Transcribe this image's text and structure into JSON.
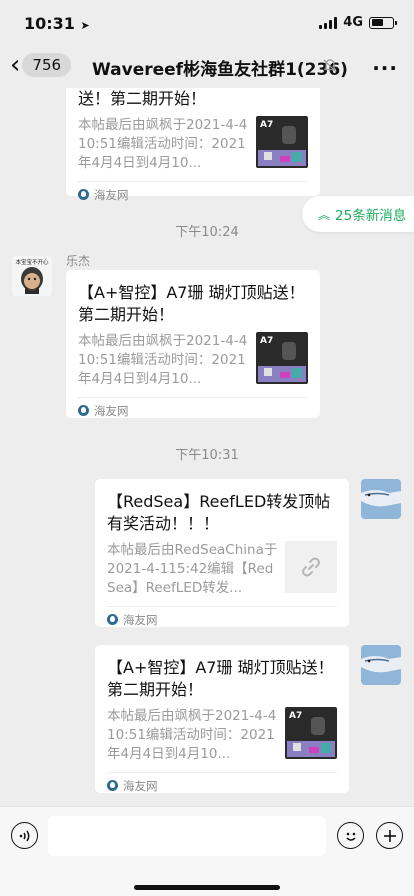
{
  "status_bar": {
    "time": "10:31",
    "network": "4G"
  },
  "nav": {
    "unread_count": "756",
    "title": "Wavereef彬海鱼友社群1(236)"
  },
  "new_messages": {
    "label": "25条新消息"
  },
  "messages": [
    {
      "title": "送！第二期开始！",
      "desc": "本帖最后由飒枫于2021-4-410:51编辑活动时间：2021年4月4日到4月10...",
      "source": "海友网",
      "thumb_label": "A7"
    },
    {
      "time_separator": "下午10:24"
    },
    {
      "sender": "乐杰",
      "avatar_caption": "本宝宝不开心",
      "title": "【A+智控】A7珊 瑚灯顶贴送！第二期开始！",
      "desc": "本帖最后由飒枫于2021-4-410:51编辑活动时间：2021年4月4日到4月10...",
      "source": "海友网",
      "thumb_label": "A7"
    },
    {
      "time_separator": "下午10:31"
    },
    {
      "title": "【RedSea】ReefLED转发顶帖有奖活动！！！",
      "desc": "本帖最后由RedSeaChina于2021-4-115:42编辑【RedSea】ReefLED转发...",
      "source": "海友网"
    },
    {
      "title": "【A+智控】A7珊 瑚灯顶贴送！第二期开始！",
      "desc": "本帖最后由飒枫于2021-4-410:51编辑活动时间：2021年4月4日到4月10...",
      "source": "海友网",
      "thumb_label": "A7"
    }
  ],
  "colors": {
    "accent_green": "#1aad5b",
    "background": "#ededed",
    "card": "#ffffff"
  }
}
